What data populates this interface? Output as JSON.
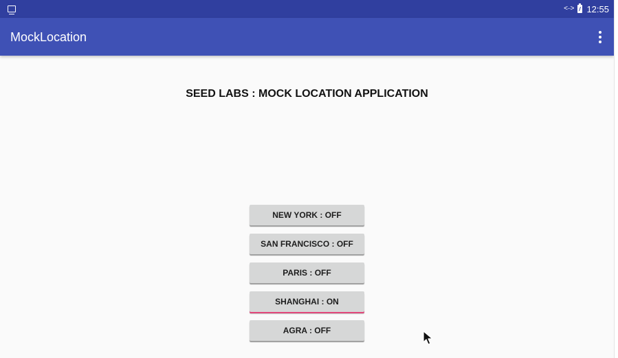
{
  "status_bar": {
    "time": "12:55",
    "left_icon": "screen-icon",
    "network_icon": "data-transfer-icon",
    "battery_icon": "battery-icon",
    "background_color": "#303f9f"
  },
  "app_bar": {
    "title": "MockLocation",
    "menu_icon": "more-vert-icon",
    "background_color": "#3f51b5"
  },
  "main": {
    "title": "SEED LABS : MOCK LOCATION APPLICATION",
    "buttons": [
      {
        "label": "NEW YORK : OFF",
        "active": false
      },
      {
        "label": "SAN FRANCISCO : OFF",
        "active": false
      },
      {
        "label": "PARIS : OFF",
        "active": false
      },
      {
        "label": "SHANGHAI : ON",
        "active": true
      },
      {
        "label": "AGRA : OFF",
        "active": false
      }
    ]
  },
  "colors": {
    "content_background": "#fafafa",
    "button_background": "#d6d7d7",
    "active_indicator": "#e1477a"
  },
  "cursor": {
    "icon": "mouse-pointer-icon"
  }
}
